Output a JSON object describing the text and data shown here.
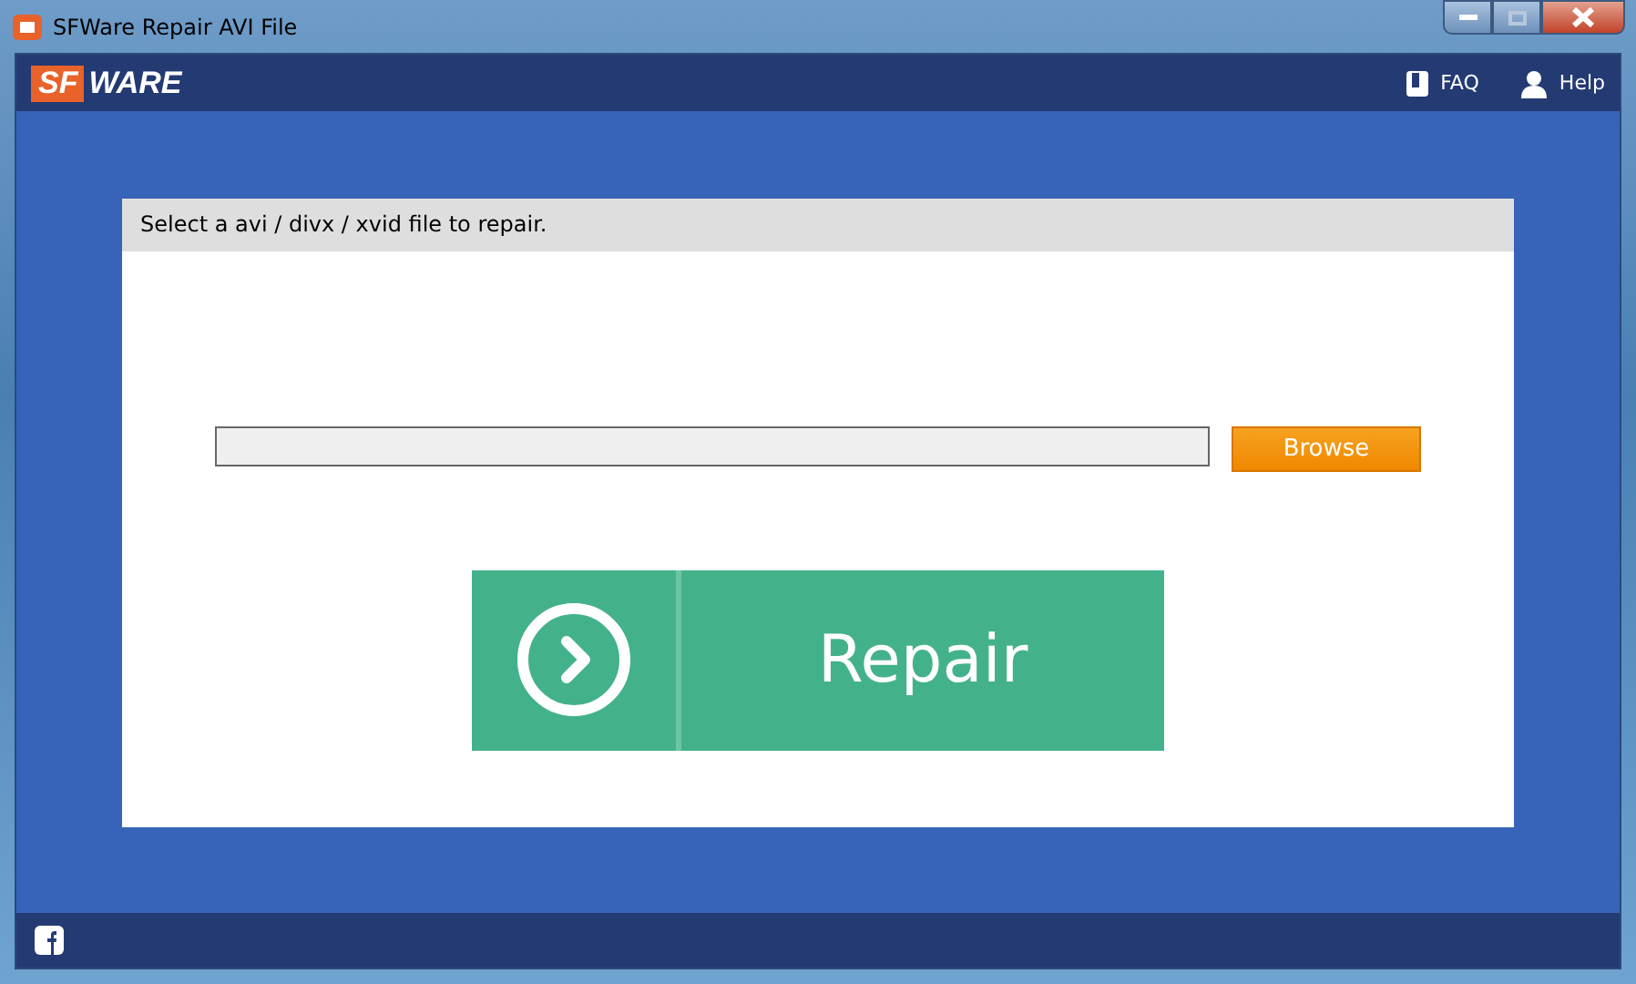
{
  "window": {
    "title": "SFWare Repair AVI File",
    "controls": [
      {
        "kind": "minimize",
        "disabled": false
      },
      {
        "kind": "maximize",
        "disabled": true
      },
      {
        "kind": "close",
        "disabled": false
      }
    ]
  },
  "header": {
    "logo": {
      "badge": "SF",
      "text": "WARE"
    },
    "links": [
      {
        "kind": "faq",
        "label": "FAQ"
      },
      {
        "kind": "help",
        "label": "Help"
      }
    ]
  },
  "panel": {
    "instruction": "Select a avi / divx / xvid file to repair.",
    "browse_button": "Browse",
    "repair_button": "Repair"
  },
  "footer": {
    "social": [
      {
        "kind": "facebook"
      }
    ]
  }
}
